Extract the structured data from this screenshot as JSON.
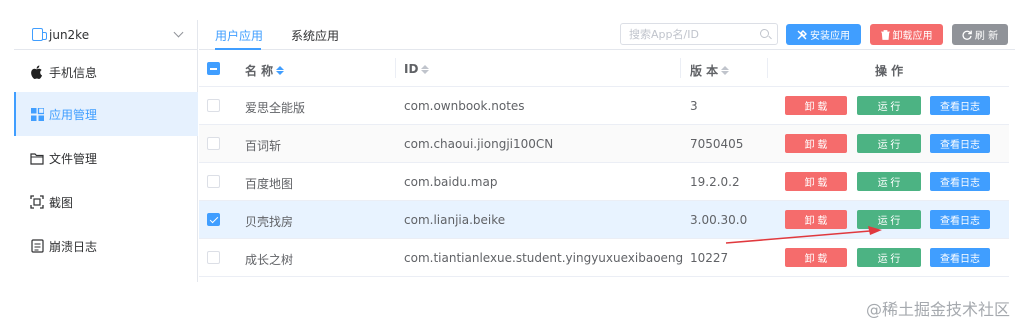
{
  "device": {
    "name": "jun2ke"
  },
  "sidebar": {
    "items": [
      {
        "label": "手机信息",
        "icon": "apple-icon"
      },
      {
        "label": "应用管理",
        "icon": "apps-grid-icon",
        "active": true
      },
      {
        "label": "文件管理",
        "icon": "folder-icon"
      },
      {
        "label": "截图",
        "icon": "screenshot-icon"
      },
      {
        "label": "崩溃日志",
        "icon": "crash-log-icon"
      }
    ]
  },
  "tabs": [
    {
      "label": "用户应用",
      "active": true
    },
    {
      "label": "系统应用",
      "active": false
    }
  ],
  "search": {
    "placeholder": "搜索App名/ID"
  },
  "toolbar": {
    "install_label": "安装应用",
    "uninstall_label": "卸载应用",
    "refresh_label": "刷 新"
  },
  "table": {
    "columns": {
      "name": "名 称",
      "id": "ID",
      "version": "版 本",
      "actions": "操 作"
    },
    "rows": [
      {
        "name": "爱思全能版",
        "id": "com.ownbook.notes",
        "version": "3",
        "selected": false
      },
      {
        "name": "百词斩",
        "id": "com.chaoui.jiongji100CN",
        "version": "7050405",
        "selected": false
      },
      {
        "name": "百度地图",
        "id": "com.baidu.map",
        "version": "19.2.0.2",
        "selected": false
      },
      {
        "name": "贝壳找房",
        "id": "com.lianjia.beike",
        "version": "3.00.30.0",
        "selected": true
      },
      {
        "name": "成长之树",
        "id": "com.tiantianlexue.student.yingyuxuexibaoeng",
        "version": "10227",
        "selected": false
      }
    ],
    "action_labels": {
      "uninstall": "卸 载",
      "run": "运 行",
      "log": "查看日志"
    }
  },
  "colors": {
    "primary": "#409eff",
    "danger": "#f56c6c",
    "success": "#4cb383",
    "arrow": "#e0393e"
  },
  "watermark": "@稀土掘金技术社区"
}
